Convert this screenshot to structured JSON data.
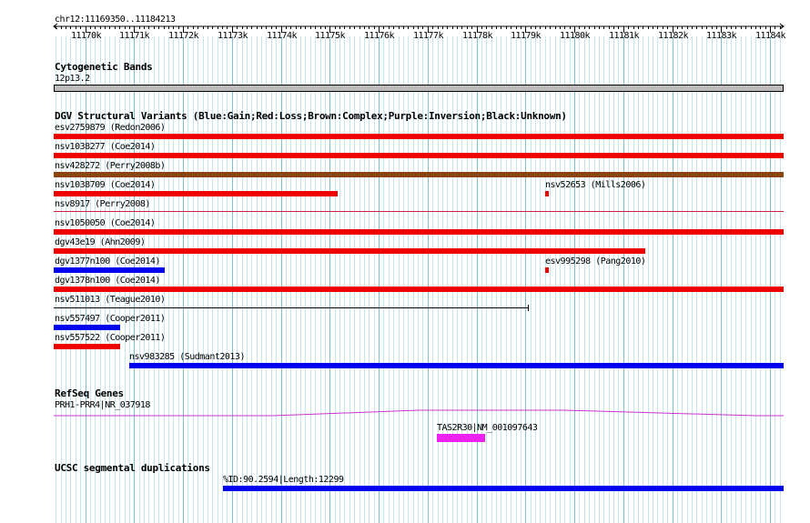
{
  "locus": "chr12:11169350..11184213",
  "ruler": {
    "ticks": [
      "11170k",
      "11171k",
      "11172k",
      "11173k",
      "11174k",
      "11175k",
      "11176k",
      "11177k",
      "11178k",
      "11179k",
      "11180k",
      "11181k",
      "11182k",
      "11183k",
      "11184k"
    ]
  },
  "cyto": {
    "title": "Cytogenetic Bands",
    "band": "12p13.2"
  },
  "dgv": {
    "title": "DGV Structural Variants (Blue:Gain;Red:Loss;Brown:Complex;Purple:Inversion;Black:Unknown)",
    "colors": {
      "gain": "#0000ee",
      "loss": "#ee0000",
      "complex": "#8b4513",
      "unknown": "#000000"
    },
    "features": [
      {
        "label": "esv2759879 (Redon2006)",
        "type": "loss"
      },
      {
        "label": "nsv1038277 (Coe2014)",
        "type": "loss"
      },
      {
        "label": "nsv428272 (Perry2008b)",
        "type": "complex"
      },
      {
        "label": "nsv1038709 (Coe2014)",
        "type": "loss"
      },
      {
        "label": "nsv52653 (Mills2006)",
        "type": "loss"
      },
      {
        "label": "nsv8917 (Perry2008)",
        "type": "loss"
      },
      {
        "label": "nsv1050050 (Coe2014)",
        "type": "loss"
      },
      {
        "label": "dgv43e19 (Ahn2009)",
        "type": "loss"
      },
      {
        "label": "dgv1377n100 (Coe2014)",
        "type": "gain"
      },
      {
        "label": "esv995298 (Pang2010)",
        "type": "loss"
      },
      {
        "label": "dgv1378n100 (Coe2014)",
        "type": "loss"
      },
      {
        "label": "nsv511013 (Teague2010)",
        "type": "unknown"
      },
      {
        "label": "nsv557497 (Cooper2011)",
        "type": "gain"
      },
      {
        "label": "nsv557522 (Cooper2011)",
        "type": "loss"
      },
      {
        "label": "nsv983285 (Sudmant2013)",
        "type": "gain"
      }
    ]
  },
  "refseq": {
    "title": "RefSeq Genes",
    "genes": [
      {
        "label": "PRH1-PRR4|NR_037918",
        "color": "#cc33cc"
      },
      {
        "label": "TAS2R30|NM_001097643",
        "color": "#ee22ee"
      }
    ]
  },
  "segdup": {
    "title": "UCSC segmental duplications",
    "items": [
      {
        "label": "%ID:90.2594|Length:12299",
        "color": "#0000ee"
      }
    ]
  }
}
